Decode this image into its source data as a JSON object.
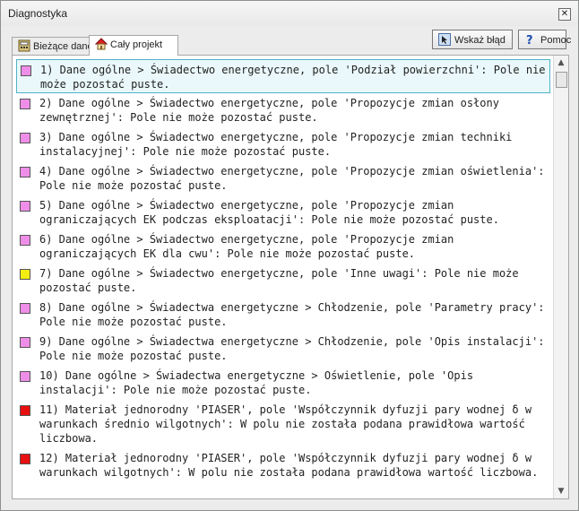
{
  "window": {
    "title": "Diagnostyka",
    "close_glyph": "✕"
  },
  "tabs": [
    {
      "label": "Bieżące dane",
      "icon": "calculator-icon"
    },
    {
      "label": "Cały projekt",
      "icon": "house-icon"
    }
  ],
  "toolbar": {
    "show_error_label": "Wskaż błąd",
    "help_label": "Pomoc"
  },
  "colors": {
    "pink": "#ee8ee8",
    "yellow": "#f2ee12",
    "red": "#e81010"
  },
  "items": [
    {
      "color": "#ee8ee8",
      "text": "1) Dane ogólne > Świadectwo energetyczne, pole 'Podział powierzchni': Pole nie może pozostać puste."
    },
    {
      "color": "#ee8ee8",
      "text": "2) Dane ogólne > Świadectwo energetyczne, pole 'Propozycje zmian osłony zewnętrznej': Pole nie może pozostać puste."
    },
    {
      "color": "#ee8ee8",
      "text": "3) Dane ogólne > Świadectwo energetyczne, pole 'Propozycje zmian techniki instalacyjnej': Pole nie może pozostać puste."
    },
    {
      "color": "#ee8ee8",
      "text": "4) Dane ogólne > Świadectwo energetyczne, pole 'Propozycje zmian oświetlenia': Pole nie może pozostać puste."
    },
    {
      "color": "#ee8ee8",
      "text": "5) Dane ogólne > Świadectwo energetyczne, pole 'Propozycje zmian ograniczających EK podczas eksploatacji': Pole nie może pozostać puste."
    },
    {
      "color": "#ee8ee8",
      "text": "6) Dane ogólne > Świadectwo energetyczne, pole 'Propozycje zmian ograniczających EK dla cwu': Pole nie może pozostać puste."
    },
    {
      "color": "#f2ee12",
      "text": "7) Dane ogólne > Świadectwo energetyczne, pole 'Inne uwagi': Pole nie może pozostać puste."
    },
    {
      "color": "#ee8ee8",
      "text": "8) Dane ogólne > Świadectwa energetyczne > Chłodzenie, pole 'Parametry pracy': Pole nie może pozostać puste."
    },
    {
      "color": "#ee8ee8",
      "text": "9) Dane ogólne > Świadectwa energetyczne > Chłodzenie, pole 'Opis instalacji': Pole nie może pozostać puste."
    },
    {
      "color": "#ee8ee8",
      "text": "10) Dane ogólne > Świadectwa energetyczne > Oświetlenie, pole 'Opis instalacji': Pole nie może pozostać puste."
    },
    {
      "color": "#e81010",
      "text": "11) Materiał jednorodny 'PIASER', pole 'Współczynnik dyfuzji pary wodnej δ w warunkach średnio wilgotnych': W polu nie została podana prawidłowa wartość liczbowa."
    },
    {
      "color": "#e81010",
      "text": "12) Materiał jednorodny 'PIASER', pole 'Współczynnik dyfuzji pary wodnej δ w warunkach wilgotnych': W polu nie została podana prawidłowa wartość liczbowa."
    }
  ]
}
